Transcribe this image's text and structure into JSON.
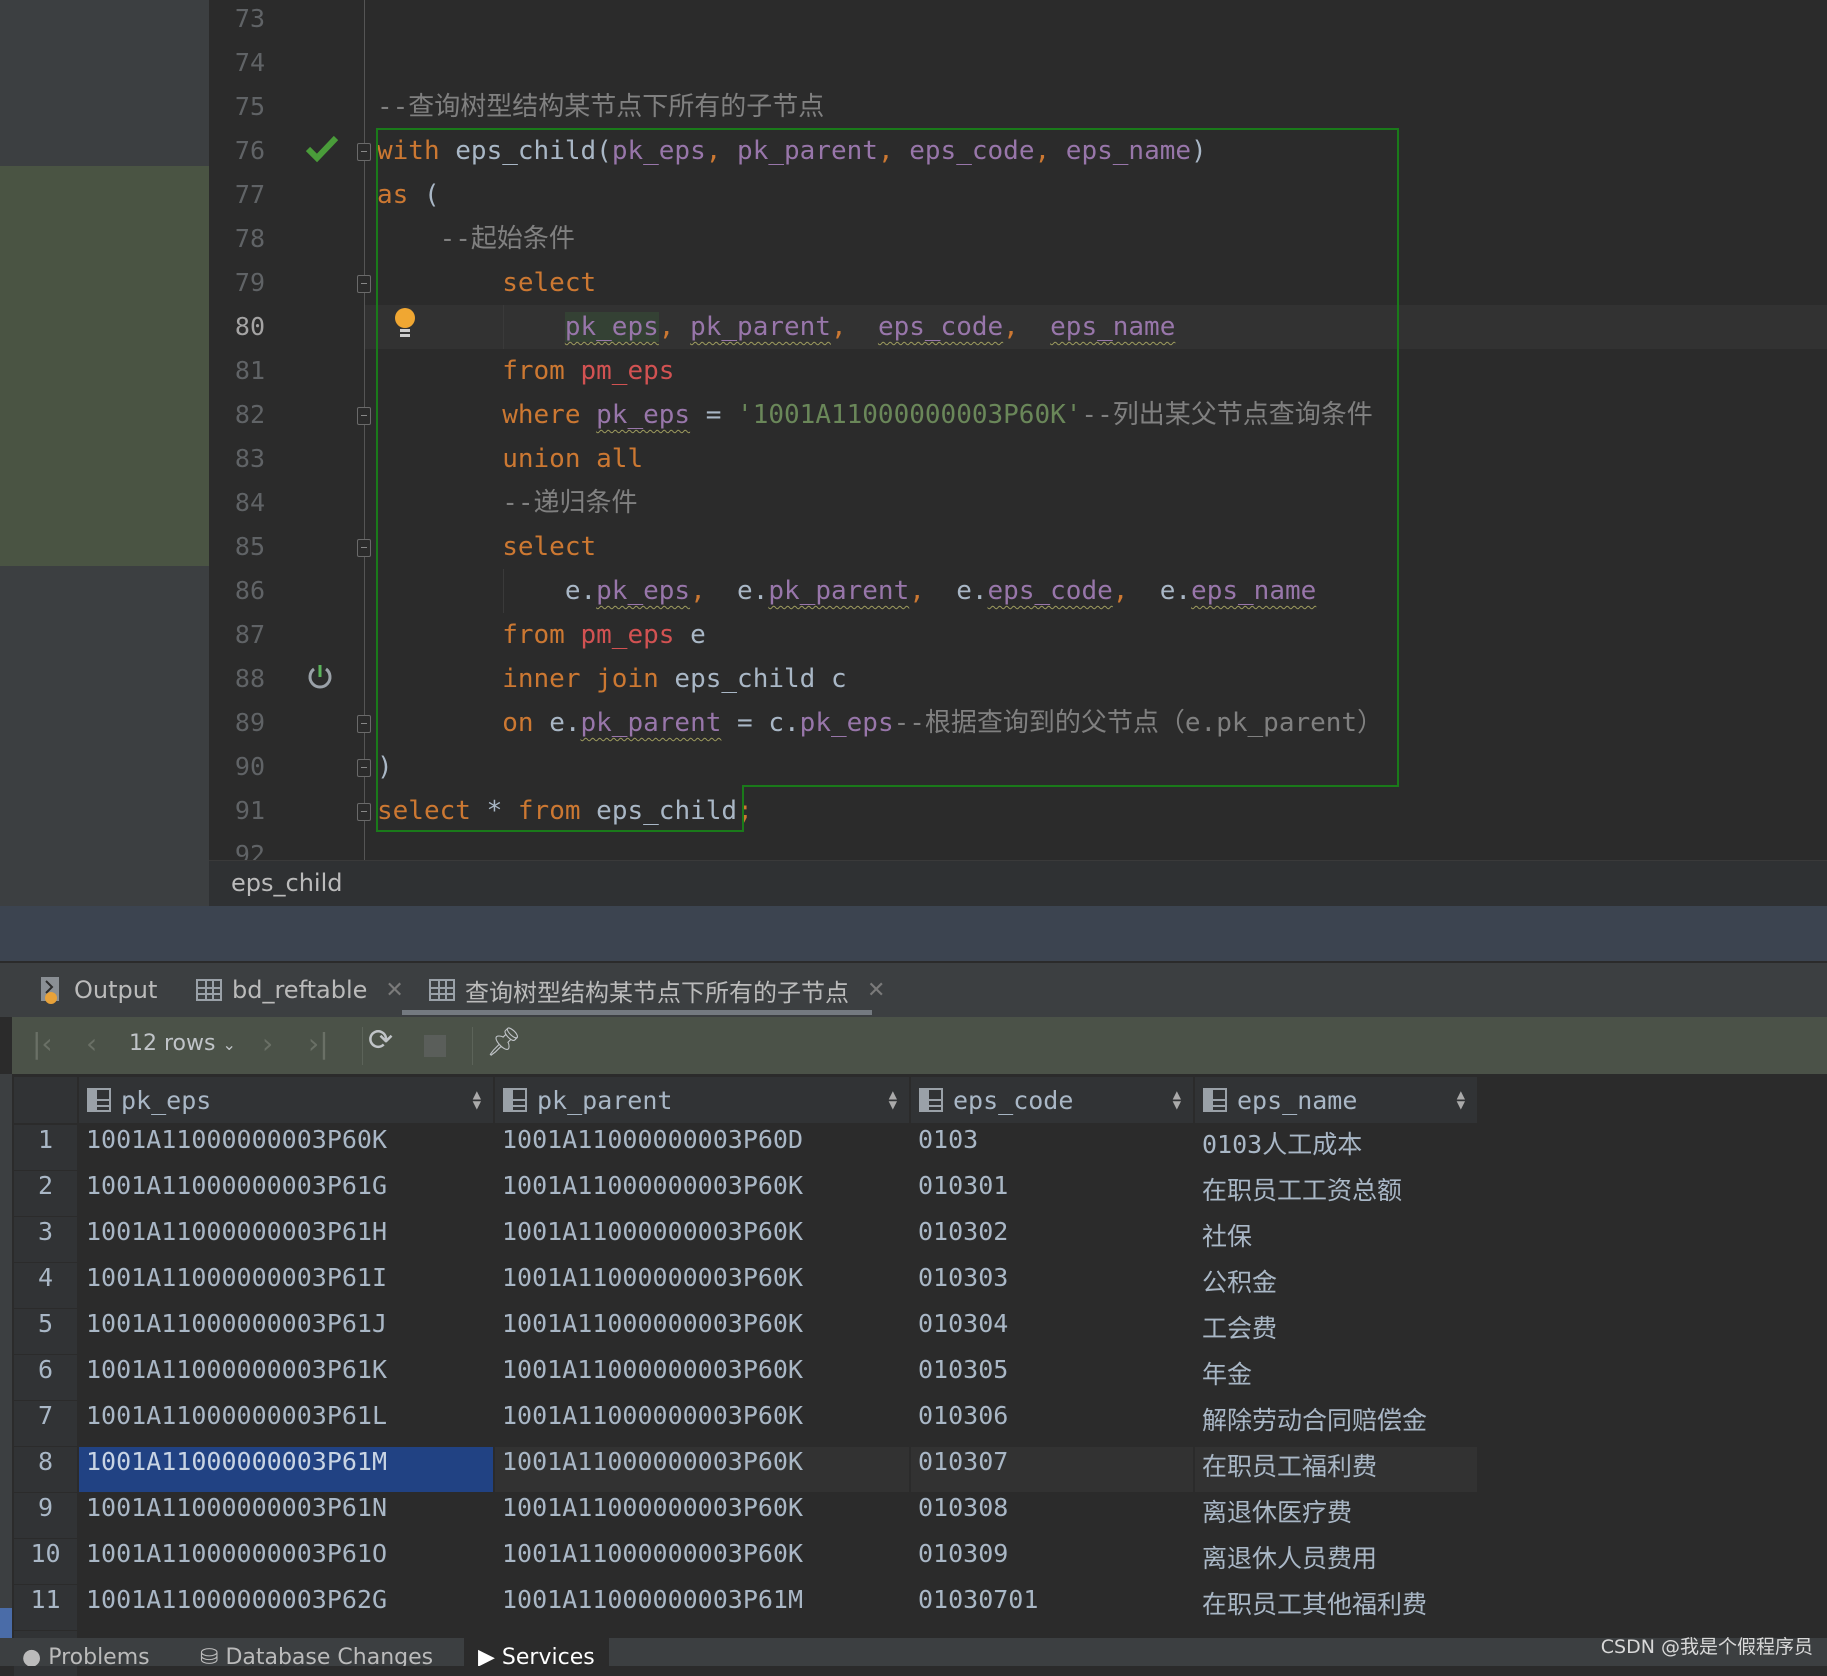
{
  "editor": {
    "first_line": 73,
    "current_line": 80,
    "lines": [
      [],
      [],
      [
        {
          "t": "--查询树型结构某节点下所有的子节点",
          "c": "cm"
        }
      ],
      [
        {
          "t": "with",
          "c": "kw"
        },
        {
          "t": " eps_child(",
          "c": "pl"
        },
        {
          "t": "pk_eps",
          "c": "id"
        },
        {
          "t": ", ",
          "c": "st"
        },
        {
          "t": "pk_parent",
          "c": "id"
        },
        {
          "t": ", ",
          "c": "st"
        },
        {
          "t": "eps_code",
          "c": "id"
        },
        {
          "t": ", ",
          "c": "st"
        },
        {
          "t": "eps_name",
          "c": "id"
        },
        {
          "t": ")",
          "c": "pl"
        }
      ],
      [
        {
          "t": "as",
          "c": "kw"
        },
        {
          "t": " (",
          "c": "pl"
        }
      ],
      [
        {
          "t": "    --起始条件",
          "c": "cm"
        }
      ],
      [
        {
          "t": "        select",
          "c": "kw"
        }
      ],
      [
        {
          "t": "            ",
          "c": "pl"
        },
        {
          "t": "pk_eps",
          "c": "id",
          "sq": true,
          "hl": true
        },
        {
          "t": ", ",
          "c": "st"
        },
        {
          "t": "pk_parent",
          "c": "id",
          "sq": true
        },
        {
          "t": ",  ",
          "c": "st"
        },
        {
          "t": "eps_code",
          "c": "id",
          "sq": true
        },
        {
          "t": ",  ",
          "c": "st"
        },
        {
          "t": "eps_name",
          "c": "id",
          "sq": true
        }
      ],
      [
        {
          "t": "        from ",
          "c": "kw"
        },
        {
          "t": "pm_eps",
          "c": "tb"
        }
      ],
      [
        {
          "t": "        where ",
          "c": "kw"
        },
        {
          "t": "pk_eps",
          "c": "id",
          "sq": true
        },
        {
          "t": " = ",
          "c": "pl"
        },
        {
          "t": "'1001A11000000003P60K'",
          "c": "str"
        },
        {
          "t": "--列出某父节点查询条件",
          "c": "cm"
        }
      ],
      [
        {
          "t": "        union all",
          "c": "kw"
        }
      ],
      [
        {
          "t": "        --递归条件",
          "c": "cm"
        }
      ],
      [
        {
          "t": "        select",
          "c": "kw"
        }
      ],
      [
        {
          "t": "            e.",
          "c": "pl"
        },
        {
          "t": "pk_eps",
          "c": "id",
          "sq": true
        },
        {
          "t": ",  ",
          "c": "st"
        },
        {
          "t": "e.",
          "c": "pl"
        },
        {
          "t": "pk_parent",
          "c": "id",
          "sq": true
        },
        {
          "t": ",  ",
          "c": "st"
        },
        {
          "t": "e.",
          "c": "pl"
        },
        {
          "t": "eps_code",
          "c": "id",
          "sq": true
        },
        {
          "t": ",  ",
          "c": "st"
        },
        {
          "t": "e.",
          "c": "pl"
        },
        {
          "t": "eps_name",
          "c": "id",
          "sq": true
        }
      ],
      [
        {
          "t": "        from ",
          "c": "kw"
        },
        {
          "t": "pm_eps",
          "c": "tb"
        },
        {
          "t": " e",
          "c": "pl"
        }
      ],
      [
        {
          "t": "        inner join ",
          "c": "kw"
        },
        {
          "t": "eps_child c",
          "c": "pl"
        }
      ],
      [
        {
          "t": "        on ",
          "c": "kw"
        },
        {
          "t": "e.",
          "c": "pl"
        },
        {
          "t": "pk_parent",
          "c": "id",
          "sq": true
        },
        {
          "t": " = c.",
          "c": "pl"
        },
        {
          "t": "pk_eps",
          "c": "id"
        },
        {
          "t": "--根据查询到的父节点（e.pk_parent）",
          "c": "cm"
        }
      ],
      [
        {
          "t": ")",
          "c": "pl"
        }
      ],
      [
        {
          "t": "select ",
          "c": "kw"
        },
        {
          "t": "* ",
          "c": "pl"
        },
        {
          "t": "from ",
          "c": "kw"
        },
        {
          "t": "eps_child",
          "c": "pl"
        },
        {
          "t": ";",
          "c": "st"
        }
      ],
      []
    ],
    "gutter_icons": {
      "76": "run-success-checkmark",
      "80": "intention-lightbulb",
      "88": "recursive-call"
    },
    "breadcrumb": "eps_child"
  },
  "tabs": [
    {
      "label": "Output",
      "icon": "output-icon",
      "closable": false
    },
    {
      "label": "bd_reftable",
      "icon": "table-icon",
      "closable": true
    },
    {
      "label": "查询树型结构某节点下所有的子节点",
      "icon": "table-icon",
      "closable": true,
      "active": true
    }
  ],
  "toolbar": {
    "rows_label": "12 rows"
  },
  "table": {
    "columns": [
      "pk_eps",
      "pk_parent",
      "eps_code",
      "eps_name"
    ],
    "rows": [
      [
        "1",
        "1001A11000000003P60K",
        "1001A11000000003P60D",
        "0103",
        "0103人工成本"
      ],
      [
        "2",
        "1001A11000000003P61G",
        "1001A11000000003P60K",
        "010301",
        "在职员工工资总额"
      ],
      [
        "3",
        "1001A11000000003P61H",
        "1001A11000000003P60K",
        "010302",
        "社保"
      ],
      [
        "4",
        "1001A11000000003P61I",
        "1001A11000000003P60K",
        "010303",
        "公积金"
      ],
      [
        "5",
        "1001A11000000003P61J",
        "1001A11000000003P60K",
        "010304",
        "工会费"
      ],
      [
        "6",
        "1001A11000000003P61K",
        "1001A11000000003P60K",
        "010305",
        "年金"
      ],
      [
        "7",
        "1001A11000000003P61L",
        "1001A11000000003P60K",
        "010306",
        "解除劳动合同赔偿金"
      ],
      [
        "8",
        "1001A11000000003P61M",
        "1001A11000000003P60K",
        "010307",
        "在职员工福利费"
      ],
      [
        "9",
        "1001A11000000003P61N",
        "1001A11000000003P60K",
        "010308",
        "离退休医疗费"
      ],
      [
        "10",
        "1001A11000000003P61O",
        "1001A11000000003P60K",
        "010309",
        "离退休人员费用"
      ],
      [
        "11",
        "1001A11000000003P62G",
        "1001A11000000003P61M",
        "01030701",
        "在职员工其他福利费"
      ]
    ],
    "selected": {
      "row": 8,
      "column": "pk_eps"
    },
    "selection_color": "#214283"
  },
  "statusbar": {
    "tabs": [
      "Problems",
      "Database Changes",
      "Services"
    ],
    "active": "Services"
  },
  "watermark": "CSDN @我是个假程序员"
}
